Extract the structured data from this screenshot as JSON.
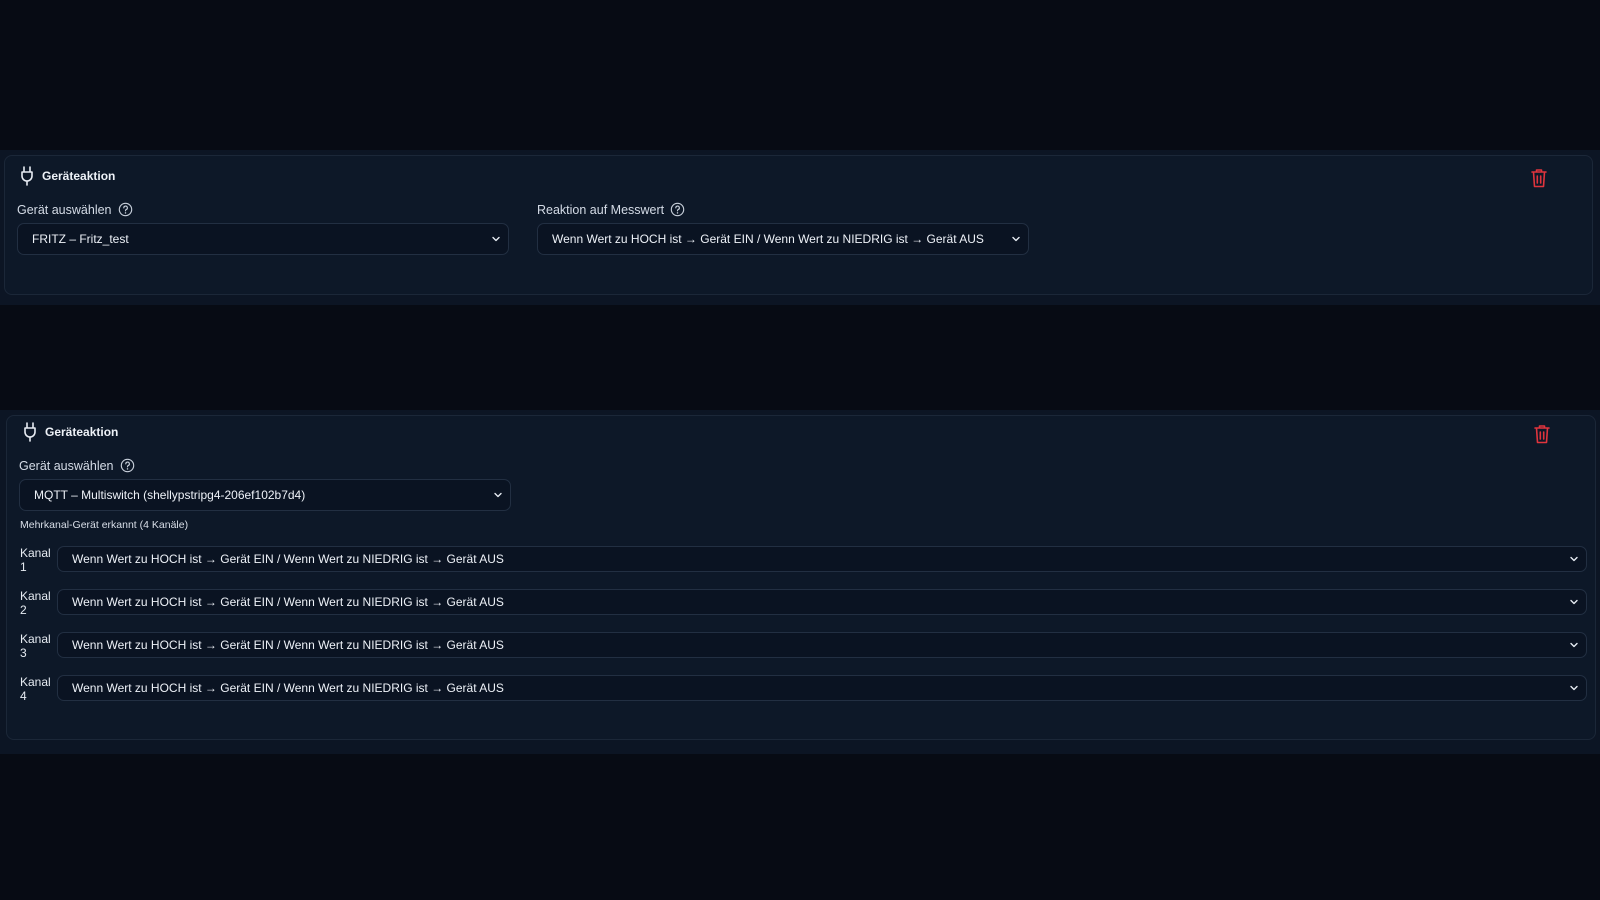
{
  "card1": {
    "title": "Geräteaktion",
    "icons": {
      "header": "plug-icon",
      "delete": "trash-icon",
      "help": "help-circle-icon"
    },
    "device_label": "Gerät auswählen",
    "device_value": "FRITZ – Fritz_test",
    "reaction_label": "Reaktion auf Messwert",
    "reaction_value": "Wenn Wert zu HOCH ist → Gerät EIN / Wenn Wert zu NIEDRIG ist → Gerät AUS"
  },
  "card2": {
    "title": "Geräteaktion",
    "icons": {
      "header": "plug-icon",
      "delete": "trash-icon",
      "help": "help-circle-icon"
    },
    "device_label": "Gerät auswählen",
    "device_value": "MQTT – Multiswitch (shellypstripg4-206ef102b7d4)",
    "hint": "Mehrkanal-Gerät erkannt (4 Kanäle)",
    "channels": [
      {
        "label_word": "Kanal",
        "label_num": "1",
        "value": "Wenn Wert zu HOCH ist → Gerät EIN / Wenn Wert zu NIEDRIG ist → Gerät AUS"
      },
      {
        "label_word": "Kanal",
        "label_num": "2",
        "value": "Wenn Wert zu HOCH ist → Gerät EIN / Wenn Wert zu NIEDRIG ist → Gerät AUS"
      },
      {
        "label_word": "Kanal",
        "label_num": "3",
        "value": "Wenn Wert zu HOCH ist → Gerät EIN / Wenn Wert zu NIEDRIG ist → Gerät AUS"
      },
      {
        "label_word": "Kanal",
        "label_num": "4",
        "value": "Wenn Wert zu HOCH ist → Gerät EIN / Wenn Wert zu NIEDRIG ist → Gerät AUS"
      }
    ]
  },
  "colors": {
    "background": "#070b14",
    "card": "#0d1828",
    "delete": "#e0343d",
    "text": "#eef2f8"
  }
}
